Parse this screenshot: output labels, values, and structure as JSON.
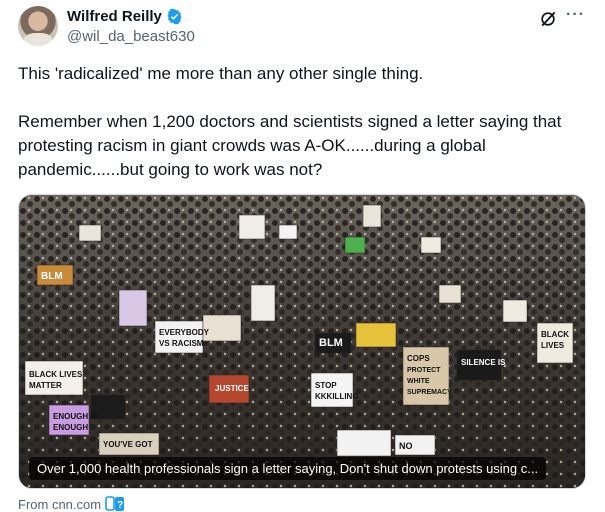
{
  "author": {
    "name": "Wilfred Reilly",
    "handle": "@wil_da_beast630",
    "verified": true
  },
  "tweet": {
    "paragraph1": "This 'radicalized' me more than any other single thing.",
    "paragraph2": "Remember when 1,200 doctors and scientists signed a letter saying that protesting racism in giant crowds was A-OK......during a global pandemic......but going to work was not?"
  },
  "media": {
    "caption": "Over 1,000 health professionals sign a letter saying, Don't shut down protests using c...",
    "signs": [
      "BLM",
      "BLACK LIVES MATTER",
      "EVERYBODY VS RACISM",
      "STOP KKKILLING",
      "COPS PROTECT WHITE SUPREMACY",
      "SILENCE IS",
      "ENOUGH IS ENOUGH",
      "BLACK LIVES",
      "JUSTICE",
      "YOU'VE GOT",
      "NO",
      "BLM"
    ]
  },
  "link": {
    "source": "From cnn.com"
  },
  "colors": {
    "verified": "#1d9bf0",
    "link_blue": "#1d9bf0"
  },
  "icons": [
    "verified-icon",
    "grok-icon",
    "more-icon",
    "source-icon"
  ]
}
